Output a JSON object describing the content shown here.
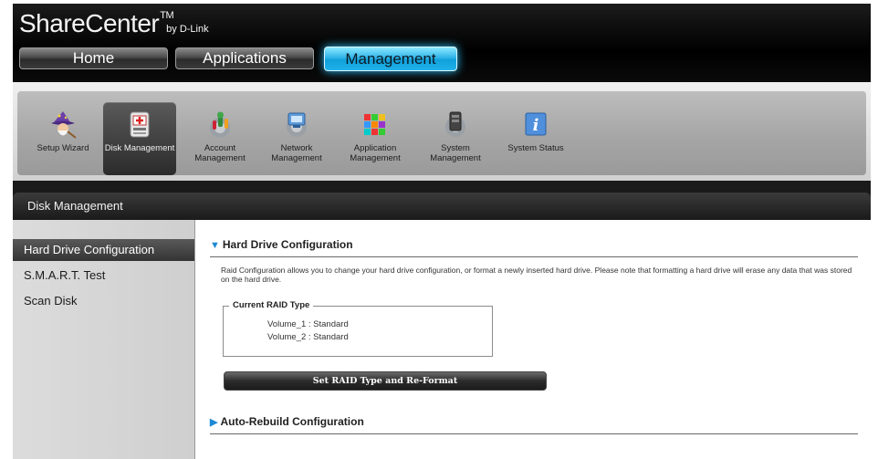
{
  "app": {
    "brand": "ShareCenter",
    "trademark": "TM",
    "byline": "by D-Link"
  },
  "main_tabs": [
    {
      "label": "Home"
    },
    {
      "label": "Applications"
    },
    {
      "label": "Management"
    }
  ],
  "toolbar": {
    "items": [
      {
        "label": "Setup Wizard",
        "icon": "wizard-icon"
      },
      {
        "label": "Disk Management",
        "icon": "disk-icon"
      },
      {
        "label": "Account Management",
        "icon": "account-icon"
      },
      {
        "label": "Network Management",
        "icon": "network-icon"
      },
      {
        "label": "Application Management",
        "icon": "application-icon"
      },
      {
        "label": "System Management",
        "icon": "system-icon"
      },
      {
        "label": "System Status",
        "icon": "info-icon"
      }
    ],
    "active": "Disk Management"
  },
  "section": {
    "title": "Disk Management"
  },
  "sidebar": {
    "items": [
      {
        "label": "Hard Drive Configuration"
      },
      {
        "label": "S.M.A.R.T. Test"
      },
      {
        "label": "Scan Disk"
      }
    ]
  },
  "content": {
    "hard_drive": {
      "heading": "Hard Drive Configuration",
      "description": "Raid Configuration allows you to change your hard drive configuration, or format a newly inserted hard drive. Please note that formatting a hard drive will erase any data that was stored on the hard drive.",
      "raid_legend": "Current RAID Type",
      "volumes": [
        "Volume_1 : Standard",
        "Volume_2 : Standard"
      ],
      "button_label": "Set RAID Type and Re-Format"
    },
    "auto_rebuild": {
      "heading": "Auto-Rebuild Configuration"
    }
  },
  "colors": {
    "accent": "#1e88d6",
    "active_tab": "#10a0da"
  }
}
